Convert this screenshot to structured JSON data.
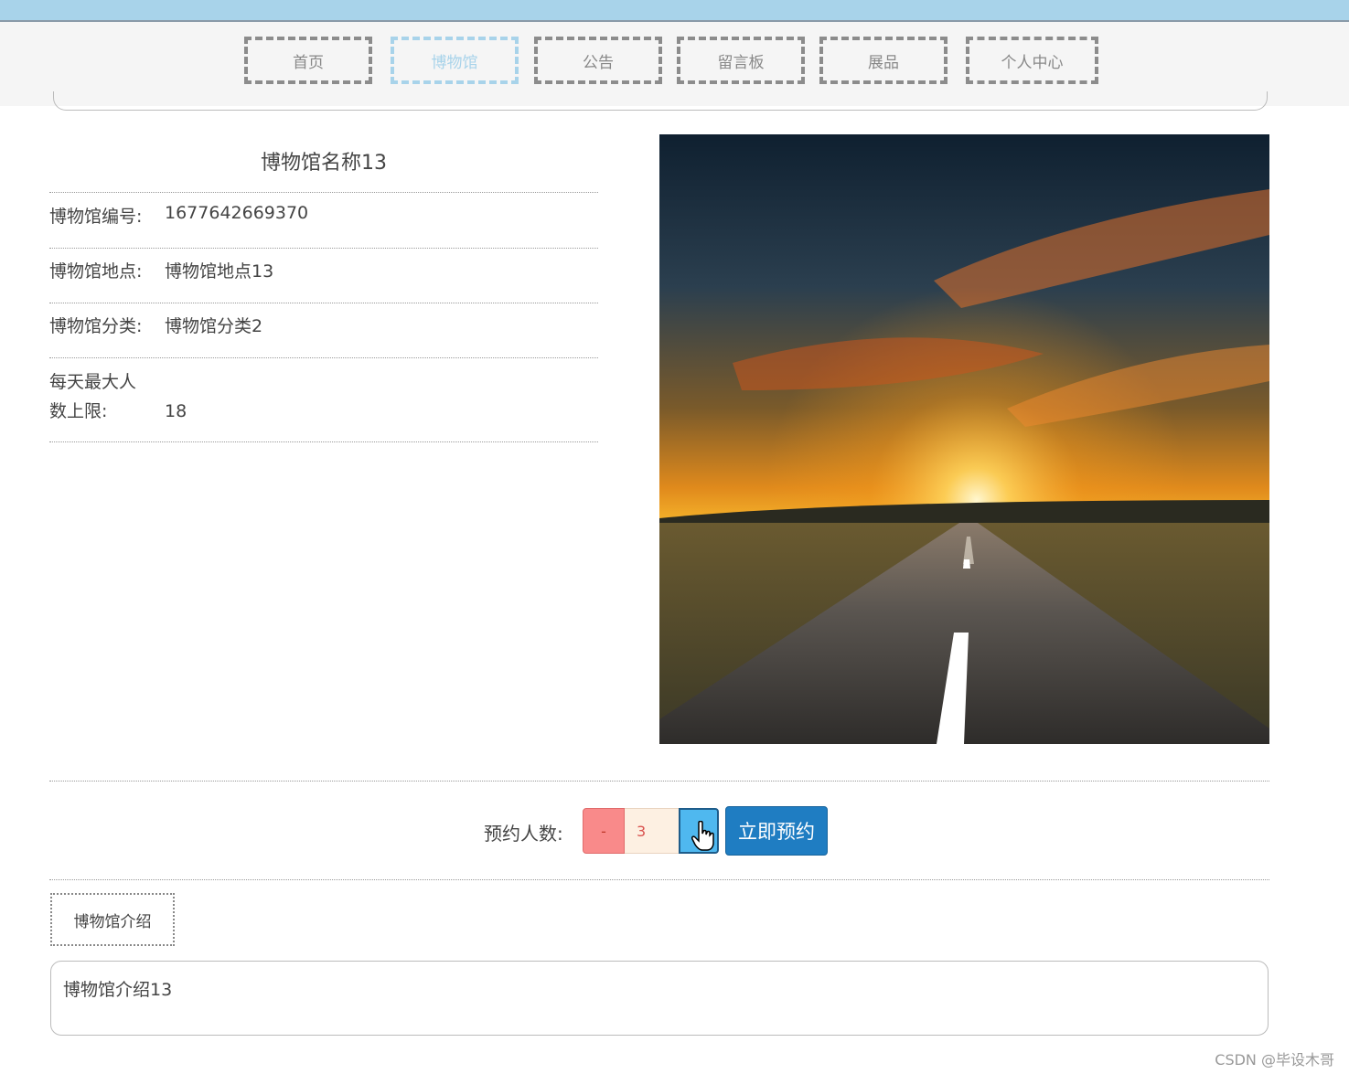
{
  "nav": {
    "items": [
      {
        "label": "首页",
        "active": false
      },
      {
        "label": "博物馆",
        "active": true
      },
      {
        "label": "公告",
        "active": false
      },
      {
        "label": "留言板",
        "active": false
      },
      {
        "label": "展品",
        "active": false
      },
      {
        "label": "个人中心",
        "active": false
      }
    ],
    "active_color": "#a8d3ea"
  },
  "detail": {
    "title": "博物馆名称13",
    "fields": [
      {
        "label": "博物馆编号:",
        "value": "1677642669370"
      },
      {
        "label": "博物馆地点:",
        "value": "博物馆地点13"
      },
      {
        "label": "博物馆分类:",
        "value": "博物馆分类2"
      },
      {
        "label": "每天最大人数上限:",
        "value": "18"
      }
    ]
  },
  "booking": {
    "label": "预约人数:",
    "minus_label": "-",
    "quantity": "3",
    "submit_label": "立即预约"
  },
  "intro": {
    "tab_label": "博物馆介绍",
    "content": "博物馆介绍13"
  },
  "watermark": "CSDN @毕设木哥"
}
